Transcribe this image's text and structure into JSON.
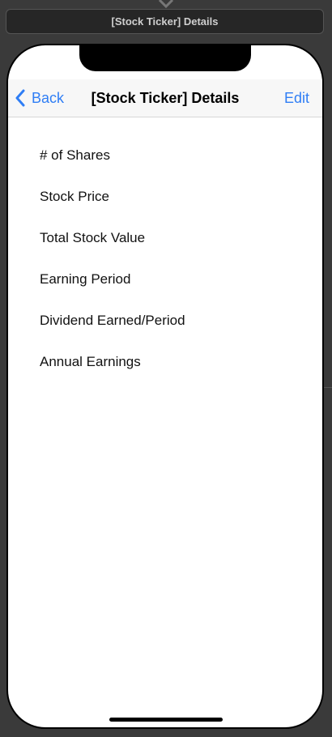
{
  "scene": {
    "title": "[Stock Ticker] Details"
  },
  "nav": {
    "back_label": "Back",
    "title": "[Stock Ticker] Details",
    "edit_label": "Edit"
  },
  "details": {
    "items": [
      {
        "label": "# of Shares"
      },
      {
        "label": "Stock Price"
      },
      {
        "label": "Total Stock Value"
      },
      {
        "label": "Earning Period"
      },
      {
        "label": "Dividend Earned/Period"
      },
      {
        "label": "Annual Earnings"
      }
    ]
  },
  "colors": {
    "canvas_background": "#3a3a3a",
    "accent": "#2f7ef5",
    "nav_background": "#f7f7f7"
  },
  "icons": {
    "segue": "down-arrow-icon",
    "back": "chevron-left-icon"
  }
}
